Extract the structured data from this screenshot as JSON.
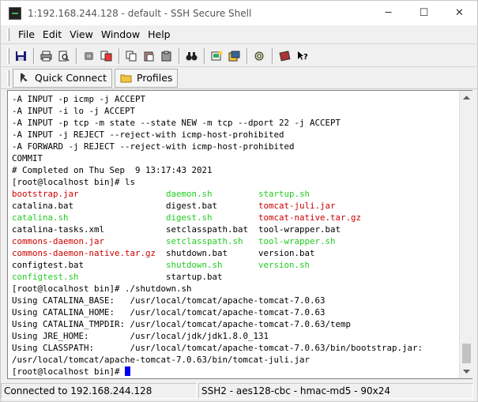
{
  "window": {
    "title": "1:192.168.244.128 - default - SSH Secure Shell",
    "minimize_glyph": "─",
    "maximize_glyph": "☐",
    "close_glyph": "✕"
  },
  "menu": {
    "file": "File",
    "edit": "Edit",
    "view": "View",
    "window": "Window",
    "help": "Help"
  },
  "quickbar": {
    "quick_connect": "Quick Connect",
    "profiles": "Profiles"
  },
  "terminal": {
    "lines": [
      [
        {
          "t": "-A INPUT -p icmp -j ACCEPT",
          "c": ""
        }
      ],
      [
        {
          "t": "-A INPUT -i lo -j ACCEPT",
          "c": ""
        }
      ],
      [
        {
          "t": "-A INPUT -p tcp -m state --state NEW -m tcp --dport 22 -j ACCEPT",
          "c": ""
        }
      ],
      [
        {
          "t": "-A INPUT -j REJECT --reject-with icmp-host-prohibited",
          "c": ""
        }
      ],
      [
        {
          "t": "-A FORWARD -j REJECT --reject-with icmp-host-prohibited",
          "c": ""
        }
      ],
      [
        {
          "t": "COMMIT",
          "c": ""
        }
      ],
      [
        {
          "t": "# Completed on Thu Sep  9 13:17:43 2021",
          "c": ""
        }
      ],
      [
        {
          "t": "[root@localhost bin]# ls",
          "c": ""
        }
      ],
      [
        {
          "t": "bootstrap.jar",
          "c": "red",
          "w": 30
        },
        {
          "t": "daemon.sh",
          "c": "green",
          "w": 18
        },
        {
          "t": "startup.sh",
          "c": "green"
        }
      ],
      [
        {
          "t": "catalina.bat",
          "c": "",
          "w": 30
        },
        {
          "t": "digest.bat",
          "c": "",
          "w": 18
        },
        {
          "t": "tomcat-juli.jar",
          "c": "red"
        }
      ],
      [
        {
          "t": "catalina.sh",
          "c": "green",
          "w": 30
        },
        {
          "t": "digest.sh",
          "c": "green",
          "w": 18
        },
        {
          "t": "tomcat-native.tar.gz",
          "c": "red"
        }
      ],
      [
        {
          "t": "catalina-tasks.xml",
          "c": "",
          "w": 30
        },
        {
          "t": "setclasspath.bat",
          "c": "",
          "w": 18
        },
        {
          "t": "tool-wrapper.bat",
          "c": ""
        }
      ],
      [
        {
          "t": "commons-daemon.jar",
          "c": "red",
          "w": 30
        },
        {
          "t": "setclasspath.sh",
          "c": "green",
          "w": 18
        },
        {
          "t": "tool-wrapper.sh",
          "c": "green"
        }
      ],
      [
        {
          "t": "commons-daemon-native.tar.gz",
          "c": "red",
          "w": 30
        },
        {
          "t": "shutdown.bat",
          "c": "",
          "w": 18
        },
        {
          "t": "version.bat",
          "c": ""
        }
      ],
      [
        {
          "t": "configtest.bat",
          "c": "",
          "w": 30
        },
        {
          "t": "shutdown.sh",
          "c": "green",
          "w": 18
        },
        {
          "t": "version.sh",
          "c": "green"
        }
      ],
      [
        {
          "t": "configtest.sh",
          "c": "green",
          "w": 30
        },
        {
          "t": "startup.bat",
          "c": ""
        }
      ],
      [
        {
          "t": "[root@localhost bin]# ./shutdown.sh",
          "c": ""
        }
      ],
      [
        {
          "t": "Using CATALINA_BASE:   /usr/local/tomcat/apache-tomcat-7.0.63",
          "c": ""
        }
      ],
      [
        {
          "t": "Using CATALINA_HOME:   /usr/local/tomcat/apache-tomcat-7.0.63",
          "c": ""
        }
      ],
      [
        {
          "t": "Using CATALINA_TMPDIR: /usr/local/tomcat/apache-tomcat-7.0.63/temp",
          "c": ""
        }
      ],
      [
        {
          "t": "Using JRE_HOME:        /usr/local/jdk/jdk1.8.0_131",
          "c": ""
        }
      ],
      [
        {
          "t": "Using CLASSPATH:       /usr/local/tomcat/apache-tomcat-7.0.63/bin/bootstrap.jar:",
          "c": ""
        }
      ],
      [
        {
          "t": "/usr/local/tomcat/apache-tomcat-7.0.63/bin/tomcat-juli.jar",
          "c": ""
        }
      ],
      [
        {
          "t": "[root@localhost bin]# ",
          "c": ""
        }
      ]
    ]
  },
  "status": {
    "connection": "Connected to 192.168.244.128",
    "cipher": "SSH2 - aes128-cbc - hmac-md5 - 90x24"
  },
  "colors": {
    "red": "#cc0000",
    "green": "#22cc22",
    "cursor": "#0000ee"
  }
}
